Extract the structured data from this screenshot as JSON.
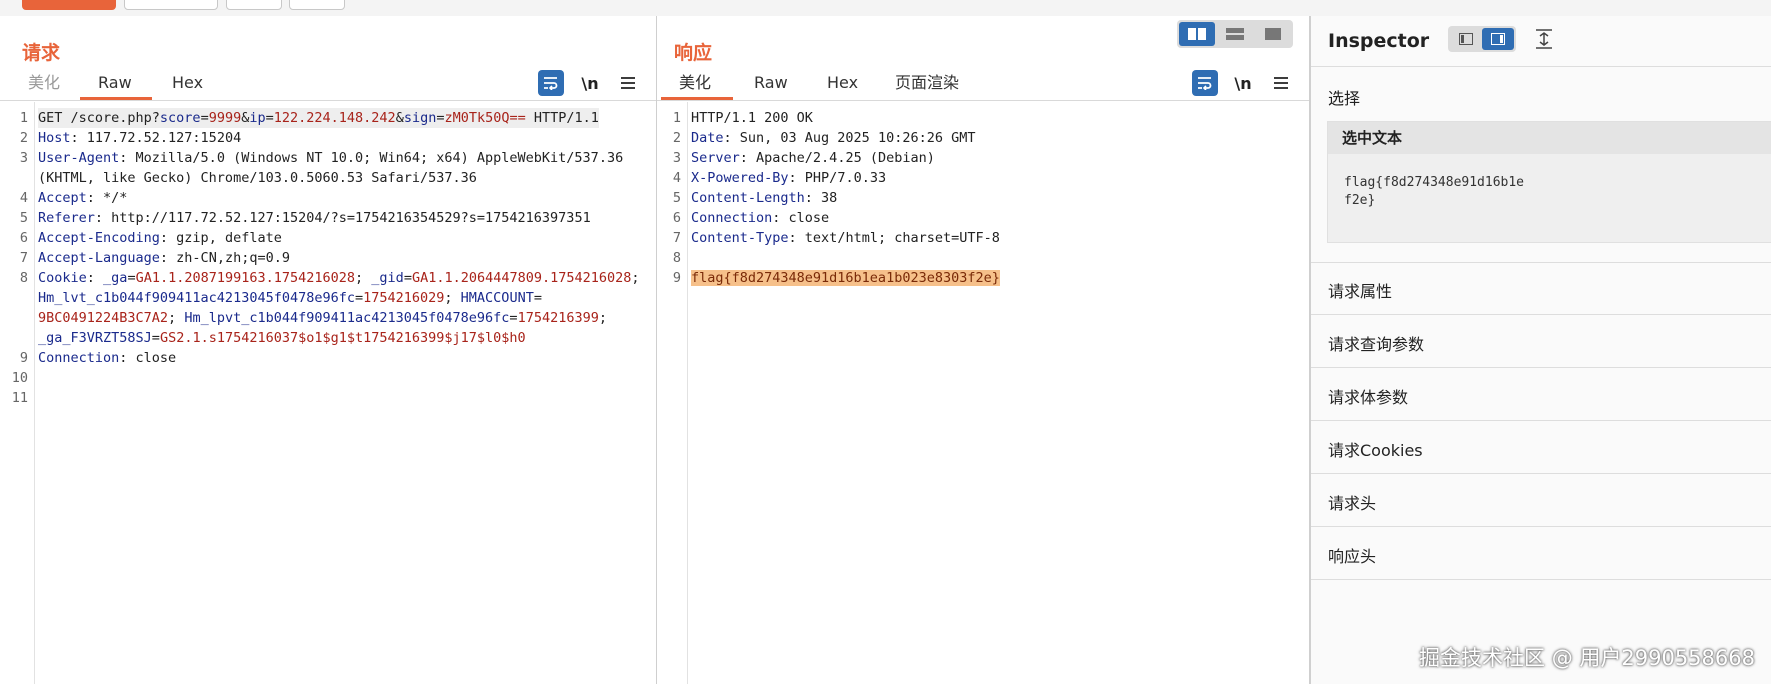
{
  "request": {
    "title": "请求",
    "tabs": [
      "美化",
      "Raw",
      "Hex"
    ],
    "active_tab": "Raw",
    "newline_label": "\\n",
    "lines": [
      {
        "n": "1",
        "parts": [
          [
            "t",
            "GET /score.php?"
          ],
          [
            "k",
            "score"
          ],
          [
            "t",
            "="
          ],
          [
            "v",
            "9999"
          ],
          [
            "t",
            "&"
          ],
          [
            "k",
            "ip"
          ],
          [
            "t",
            "="
          ],
          [
            "v",
            "122.224.148.242"
          ],
          [
            "t",
            "&"
          ],
          [
            "k",
            "sign"
          ],
          [
            "t",
            "="
          ],
          [
            "v",
            "zM0Tk50Q=="
          ],
          [
            "t",
            " HTTP/1.1"
          ]
        ]
      },
      {
        "n": "2",
        "parts": [
          [
            "k",
            "Host"
          ],
          [
            "t",
            ": 117.72.52.127:15204"
          ]
        ]
      },
      {
        "n": "3",
        "parts": [
          [
            "k",
            "User-Agent"
          ],
          [
            "t",
            ": Mozilla/5.0 (Windows NT 10.0; Win64; x64) AppleWebKit/537.36"
          ]
        ]
      },
      {
        "n": "",
        "parts": [
          [
            "t",
            "(KHTML, like Gecko) Chrome/103.0.5060.53 Safari/537.36"
          ]
        ]
      },
      {
        "n": "4",
        "parts": [
          [
            "k",
            "Accept"
          ],
          [
            "t",
            ": */*"
          ]
        ]
      },
      {
        "n": "5",
        "parts": [
          [
            "k",
            "Referer"
          ],
          [
            "t",
            ": http://117.72.52.127:15204/?s=1754216354529?s=1754216397351"
          ]
        ]
      },
      {
        "n": "6",
        "parts": [
          [
            "k",
            "Accept-Encoding"
          ],
          [
            "t",
            ": gzip, deflate"
          ]
        ]
      },
      {
        "n": "7",
        "parts": [
          [
            "k",
            "Accept-Language"
          ],
          [
            "t",
            ": zh-CN,zh;q=0.9"
          ]
        ]
      },
      {
        "n": "8",
        "parts": [
          [
            "k",
            "Cookie"
          ],
          [
            "t",
            ": "
          ],
          [
            "k",
            "_ga"
          ],
          [
            "t",
            "="
          ],
          [
            "v",
            "GA1.1.2087199163.1754216028"
          ],
          [
            "t",
            "; "
          ],
          [
            "k",
            "_gid"
          ],
          [
            "t",
            "="
          ],
          [
            "v",
            "GA1.1.2064447809.1754216028"
          ],
          [
            "t",
            ";"
          ]
        ]
      },
      {
        "n": "",
        "parts": [
          [
            "k",
            "Hm_lvt_c1b044f909411ac4213045f0478e96fc"
          ],
          [
            "t",
            "="
          ],
          [
            "v",
            "1754216029"
          ],
          [
            "t",
            "; "
          ],
          [
            "k",
            "HMACCOUNT"
          ],
          [
            "t",
            "="
          ]
        ]
      },
      {
        "n": "",
        "parts": [
          [
            "v",
            "9BC0491224B3C7A2"
          ],
          [
            "t",
            "; "
          ],
          [
            "k",
            "Hm_lpvt_c1b044f909411ac4213045f0478e96fc"
          ],
          [
            "t",
            "="
          ],
          [
            "v",
            "1754216399"
          ],
          [
            "t",
            ";"
          ]
        ]
      },
      {
        "n": "",
        "parts": [
          [
            "k",
            "_ga_F3VRZT58SJ"
          ],
          [
            "t",
            "="
          ],
          [
            "v",
            "GS2.1.s1754216037$o1$g1$t1754216399$j17$l0$h0"
          ]
        ]
      },
      {
        "n": "9",
        "parts": [
          [
            "k",
            "Connection"
          ],
          [
            "t",
            ": close"
          ]
        ]
      },
      {
        "n": "10",
        "parts": []
      },
      {
        "n": "11",
        "parts": []
      }
    ]
  },
  "response": {
    "title": "响应",
    "tabs": [
      "美化",
      "Raw",
      "Hex",
      "页面渲染"
    ],
    "active_tab": "美化",
    "newline_label": "\\n",
    "lines": [
      {
        "n": "1",
        "parts": [
          [
            "t",
            "HTTP/1.1 200 OK"
          ]
        ]
      },
      {
        "n": "2",
        "parts": [
          [
            "k",
            "Date"
          ],
          [
            "t",
            ": Sun, 03 Aug 2025 10:26:26 GMT"
          ]
        ]
      },
      {
        "n": "3",
        "parts": [
          [
            "k",
            "Server"
          ],
          [
            "t",
            ": Apache/2.4.25 (Debian)"
          ]
        ]
      },
      {
        "n": "4",
        "parts": [
          [
            "k",
            "X-Powered-By"
          ],
          [
            "t",
            ": PHP/7.0.33"
          ]
        ]
      },
      {
        "n": "5",
        "parts": [
          [
            "k",
            "Content-Length"
          ],
          [
            "t",
            ": 38"
          ]
        ]
      },
      {
        "n": "6",
        "parts": [
          [
            "k",
            "Connection"
          ],
          [
            "t",
            ": close"
          ]
        ]
      },
      {
        "n": "7",
        "parts": [
          [
            "k",
            "Content-Type"
          ],
          [
            "t",
            ": text/html; charset=UTF-8"
          ]
        ]
      },
      {
        "n": "8",
        "parts": []
      },
      {
        "n": "9",
        "parts": [
          [
            "flag",
            "flag{f8d274348e91d16b1ea1b023e8303f2e}"
          ]
        ]
      }
    ]
  },
  "inspector": {
    "title": "Inspector",
    "select_label": "选择",
    "selected_text_header": "选中文本",
    "selected_text_line1": "flag{f8d274348e91d16b1e",
    "selected_text_line2": "f2e}",
    "sections": [
      "请求属性",
      "请求查询参数",
      "请求体参数",
      "请求Cookies",
      "请求头",
      "响应头"
    ]
  },
  "watermark": "掘金技术社区 @ 用户2990558668"
}
